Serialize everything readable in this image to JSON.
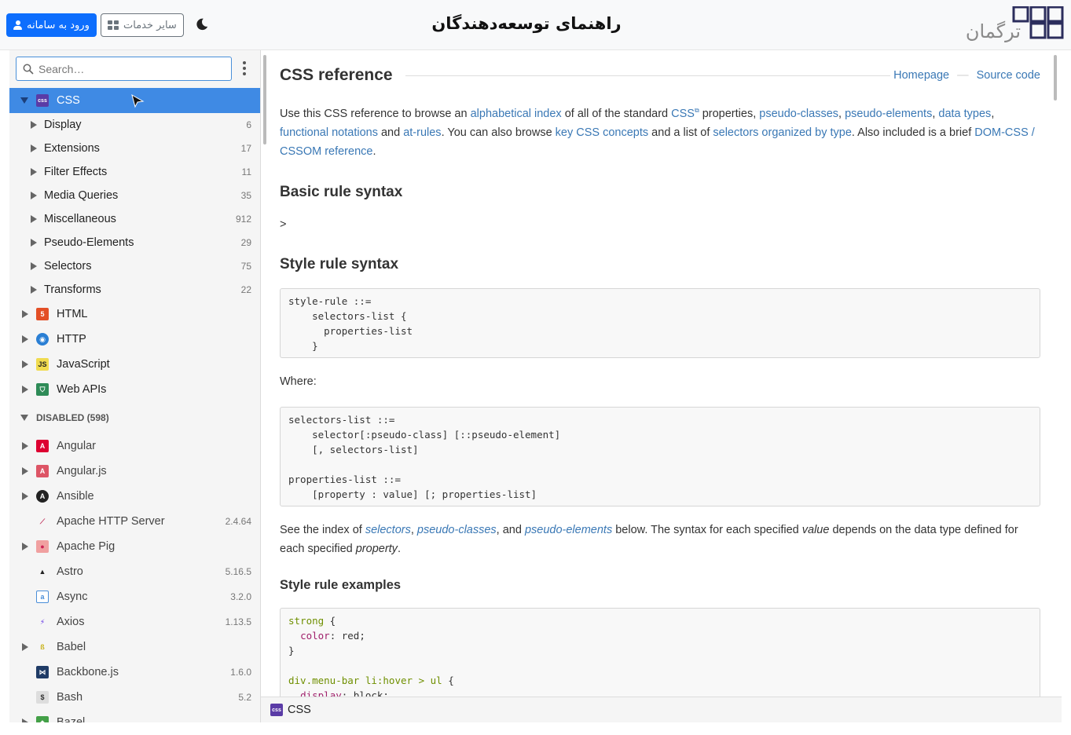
{
  "header": {
    "login_label": "ورود به سامانه",
    "services_label": "سایر خدمات",
    "title": "راهنمای توسعه‌دهندگان",
    "logo_text": "ترگمان"
  },
  "sidebar": {
    "search_placeholder": "Search…",
    "selected": {
      "label": "CSS",
      "icon": "css-icon",
      "color": "#5a3ba6"
    },
    "css_children": [
      {
        "label": "Display",
        "count": "6"
      },
      {
        "label": "Extensions",
        "count": "17"
      },
      {
        "label": "Filter Effects",
        "count": "11"
      },
      {
        "label": "Media Queries",
        "count": "35"
      },
      {
        "label": "Miscellaneous",
        "count": "912"
      },
      {
        "label": "Pseudo-Elements",
        "count": "29"
      },
      {
        "label": "Selectors",
        "count": "75"
      },
      {
        "label": "Transforms",
        "count": "22"
      }
    ],
    "enabled_docs": [
      {
        "label": "HTML",
        "icon": "html5-icon"
      },
      {
        "label": "HTTP",
        "icon": "http-icon"
      },
      {
        "label": "JavaScript",
        "icon": "javascript-icon"
      },
      {
        "label": "Web APIs",
        "icon": "web-apis-icon"
      }
    ],
    "disabled_header": "DISABLED (598)",
    "disabled_docs": [
      {
        "label": "Angular",
        "version": "",
        "icon": "angular-icon",
        "expandable": true
      },
      {
        "label": "Angular.js",
        "version": "",
        "icon": "angularjs-icon",
        "expandable": true
      },
      {
        "label": "Ansible",
        "version": "",
        "icon": "ansible-icon",
        "expandable": true
      },
      {
        "label": "Apache HTTP Server",
        "version": "2.4.64",
        "icon": "apache-feather-icon",
        "expandable": false
      },
      {
        "label": "Apache Pig",
        "version": "",
        "icon": "apache-pig-icon",
        "expandable": true
      },
      {
        "label": "Astro",
        "version": "5.16.5",
        "icon": "astro-icon",
        "expandable": false
      },
      {
        "label": "Async",
        "version": "3.2.0",
        "icon": "async-icon",
        "expandable": false
      },
      {
        "label": "Axios",
        "version": "1.13.5",
        "icon": "axios-icon",
        "expandable": false
      },
      {
        "label": "Babel",
        "version": "",
        "icon": "babel-icon",
        "expandable": true
      },
      {
        "label": "Backbone.js",
        "version": "1.6.0",
        "icon": "backbone-icon",
        "expandable": false
      },
      {
        "label": "Bash",
        "version": "5.2",
        "icon": "bash-icon",
        "expandable": false
      },
      {
        "label": "Bazel",
        "version": "",
        "icon": "bazel-icon",
        "expandable": true
      }
    ]
  },
  "content": {
    "title": "CSS reference",
    "homepage_link": "Homepage",
    "source_link": "Source code",
    "intro": {
      "t1": "Use this CSS reference to browse an ",
      "l1": "alphabetical index",
      "t2": " of all of the standard ",
      "l2": "CSS",
      "t3": " properties, ",
      "l3": "pseudo-classes",
      "t4": ", ",
      "l4": "pseudo-elements",
      "t5": ", ",
      "l5": "data types",
      "t6": ", ",
      "l6": "functional notations",
      "t7": " and ",
      "l7": "at-rules",
      "t8": ". You can also browse ",
      "l8": "key CSS concepts",
      "t9": " and a list of ",
      "l9": "selectors organized by type",
      "t10": ". Also included is a brief ",
      "l10": "DOM-CSS / CSSOM reference",
      "t11": "."
    },
    "basic_heading": "Basic rule syntax",
    "gt_symbol": ">",
    "style_heading": "Style rule syntax",
    "style_code": "style-rule ::=\n    selectors-list {\n      properties-list\n    }",
    "where_label": "Where:",
    "where_code": "selectors-list ::=\n    selector[:pseudo-class] [::pseudo-element]\n    [, selectors-list]\n\nproperties-list ::=\n    [property : value] [; properties-list]",
    "see_index": {
      "t1": "See the index of ",
      "l1": "selectors",
      "t2": ", ",
      "l2": "pseudo-classes",
      "t3": ", and ",
      "l3": "pseudo-elements",
      "t4": " below. The syntax for each specified ",
      "e1": "value",
      "t5": " depends on the data type defined for each specified ",
      "e2": "property",
      "t6": "."
    },
    "examples_heading": "Style rule examples",
    "example_code": {
      "sel1": "strong",
      "open1": " {",
      "prop1": "color",
      "val1": ": red;",
      "close1": "}",
      "sel2": "div.menu-bar li:hover > ul",
      "open2": " {",
      "prop2": "display",
      "val2": ": block;"
    }
  },
  "bottombar": {
    "label": "CSS"
  }
}
